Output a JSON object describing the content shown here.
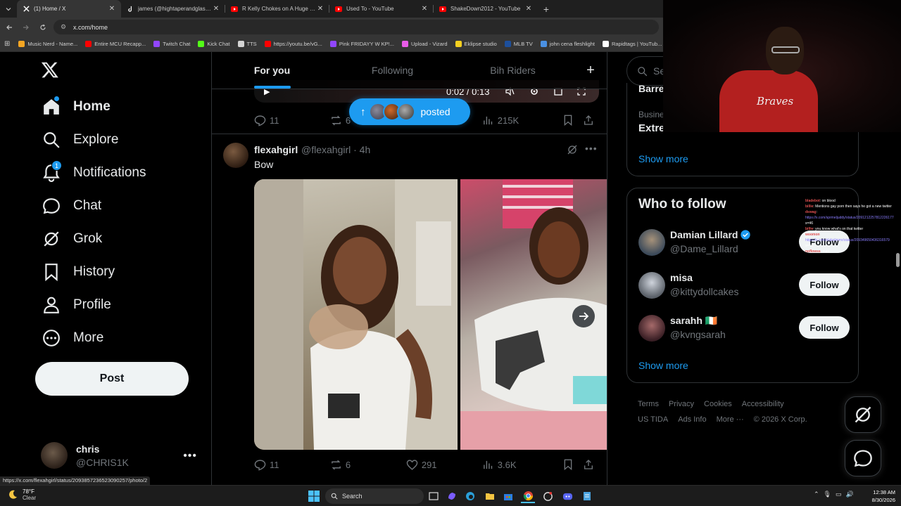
{
  "browser": {
    "tabs": [
      {
        "title": "(1) Home / X",
        "active": true,
        "favicon": "x-icon"
      },
      {
        "title": "james (@hightaperandglasses)",
        "active": false,
        "favicon": "tiktok-icon"
      },
      {
        "title": "R Kelly Chokes on A Huge Ciga",
        "active": false,
        "favicon": "youtube-icon"
      },
      {
        "title": "Used To - YouTube",
        "active": false,
        "favicon": "youtube-icon"
      },
      {
        "title": "ShakeDown2012 - YouTube",
        "active": false,
        "favicon": "youtube-icon"
      }
    ],
    "url": "x.com/home",
    "bookmarks": [
      {
        "label": "Music Nerd - Name...",
        "color": "#f5a623"
      },
      {
        "label": "Entire MCU Recapp...",
        "color": "#ff0000"
      },
      {
        "label": "Twitch Chat",
        "color": "#9146ff"
      },
      {
        "label": "Kick Chat",
        "color": "#53fc18"
      },
      {
        "label": "TTS",
        "color": "#d4d4d4"
      },
      {
        "label": "https://youtu.be/vG...",
        "color": "#ff0000"
      },
      {
        "label": "Pink FRIDAYY W KP!...",
        "color": "#9146ff"
      },
      {
        "label": "Upload - Vizard",
        "color": "#e85ce8"
      },
      {
        "label": "Eklipse studio",
        "color": "#f5d020"
      },
      {
        "label": "MLB TV",
        "color": "#1d4f9c"
      },
      {
        "label": "john cena fleshlight",
        "color": "#4a90e2"
      },
      {
        "label": "Rapidtags | YouTub...",
        "color": "#ffffff"
      }
    ]
  },
  "sidebar": {
    "items": [
      {
        "label": "Home",
        "icon": "home-icon",
        "active": true
      },
      {
        "label": "Explore",
        "icon": "search-icon"
      },
      {
        "label": "Notifications",
        "icon": "bell-icon",
        "badge": "1"
      },
      {
        "label": "Chat",
        "icon": "chat-icon"
      },
      {
        "label": "Grok",
        "icon": "grok-icon"
      },
      {
        "label": "History",
        "icon": "bookmark-icon"
      },
      {
        "label": "Profile",
        "icon": "person-icon"
      },
      {
        "label": "More",
        "icon": "more-circle-icon"
      }
    ],
    "post_label": "Post",
    "account": {
      "name": "chris",
      "handle": "@CHRIS1K"
    }
  },
  "timeline": {
    "tabs": [
      "For you",
      "Following",
      "Bih Riders"
    ],
    "video": {
      "time": "0:02 / 0:13"
    },
    "prev_stats": {
      "replies": "11",
      "reposts": "6",
      "views": "215K"
    },
    "posted_pill": "posted",
    "post": {
      "name": "flexahgirl",
      "handle": "@flexahgirl · 4h",
      "text": "Bow",
      "stats": {
        "replies": "11",
        "reposts": "6",
        "likes": "291",
        "views": "3.6K"
      }
    }
  },
  "right": {
    "search_placeholder": "Sea",
    "trend_top": "Barre",
    "trend_category": "Busine",
    "trend_name": "Extre",
    "show_more": "Show more",
    "who_to_follow_title": "Who to follow",
    "follow_suggestions": [
      {
        "name": "Damian Lillard",
        "handle": "@Dame_Lillard",
        "verified": true,
        "button": "Follow"
      },
      {
        "name": "misa",
        "handle": "@kittydollcakes",
        "verified": false,
        "button": "Follow"
      },
      {
        "name": "sarahh 🇮🇪",
        "handle": "@kvngsarah",
        "verified": false,
        "button": "Follow"
      }
    ],
    "footer": [
      "Terms",
      "Privacy",
      "Cookies",
      "Accessibility",
      "US TIDA",
      "Ads Info",
      "More ···",
      "© 2026 X Corp."
    ]
  },
  "chat_overlay": [
    {
      "user": "bladebot",
      "msg": ": on blood"
    },
    {
      "user": "billie",
      "msg": ": Mentions gay porn then says he got a new twitter"
    },
    {
      "user": "dswag",
      "msg": ":"
    },
    {
      "user": "",
      "msg": "https://x.com/sprmeljuddy/status/2091212257812226177"
    },
    {
      "user": "",
      "msg": "s=46"
    },
    {
      "user": "billie",
      "msg": ": you know what's on that twitter"
    },
    {
      "user": "woomon",
      "msg": ""
    },
    {
      "user": "",
      "msg": "https://x.com/slabslimmr/status/209349650436316579"
    },
    {
      "user": "",
      "msg": "s=46"
    },
    {
      "user": "noflowss",
      "msg": ": man"
    }
  ],
  "status_url": "https://x.com/flexahgirl/status/2093857236523090257/photo/2",
  "taskbar": {
    "weather_temp": "78°F",
    "weather_cond": "Clear",
    "search_label": "Search",
    "time": "12:38 AM",
    "date": "8/30/2026"
  }
}
